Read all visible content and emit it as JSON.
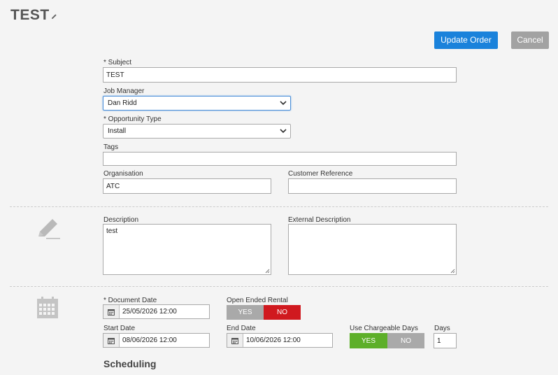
{
  "page": {
    "title": "TEST"
  },
  "toolbar": {
    "update_label": "Update Order",
    "cancel_label": "Cancel"
  },
  "form": {
    "subject": {
      "label": "* Subject",
      "value": "TEST"
    },
    "job_manager": {
      "label": "Job Manager",
      "value": "Dan Ridd"
    },
    "opportunity_type": {
      "label": "* Opportunity Type",
      "value": "Install"
    },
    "tags": {
      "label": "Tags",
      "value": ""
    },
    "organisation": {
      "label": "Organisation",
      "value": "ATC"
    },
    "customer_reference": {
      "label": "Customer Reference",
      "value": ""
    },
    "description": {
      "label": "Description",
      "value": "test"
    },
    "external_description": {
      "label": "External Description",
      "value": ""
    },
    "document_date": {
      "label": "* Document Date",
      "value": "25/05/2026 12:00"
    },
    "open_ended_rental": {
      "label": "Open Ended Rental",
      "yes": "YES",
      "no": "NO",
      "selected": "NO"
    },
    "start_date": {
      "label": "Start Date",
      "value": "08/06/2026 12:00"
    },
    "end_date": {
      "label": "End Date",
      "value": "10/06/2026 12:00"
    },
    "use_chargeable_days": {
      "label": "Use Chargeable Days",
      "yes": "YES",
      "no": "NO",
      "selected": "YES"
    },
    "days": {
      "label": "Days",
      "value": "1"
    }
  },
  "sections": {
    "scheduling": "Scheduling"
  },
  "icons": {
    "title_edit": "pencil-icon",
    "section_description": "pencil-icon",
    "section_dates": "calendar-icon",
    "date_picker": "calendar-icon",
    "dropdown": "chevron-down-icon"
  },
  "colors": {
    "primary": "#1a82db",
    "cancel": "#a2a2a2",
    "toggle_no_active": "#d0191f",
    "toggle_yes_active": "#5daf29",
    "toggle_inactive": "#a9a9a9"
  }
}
